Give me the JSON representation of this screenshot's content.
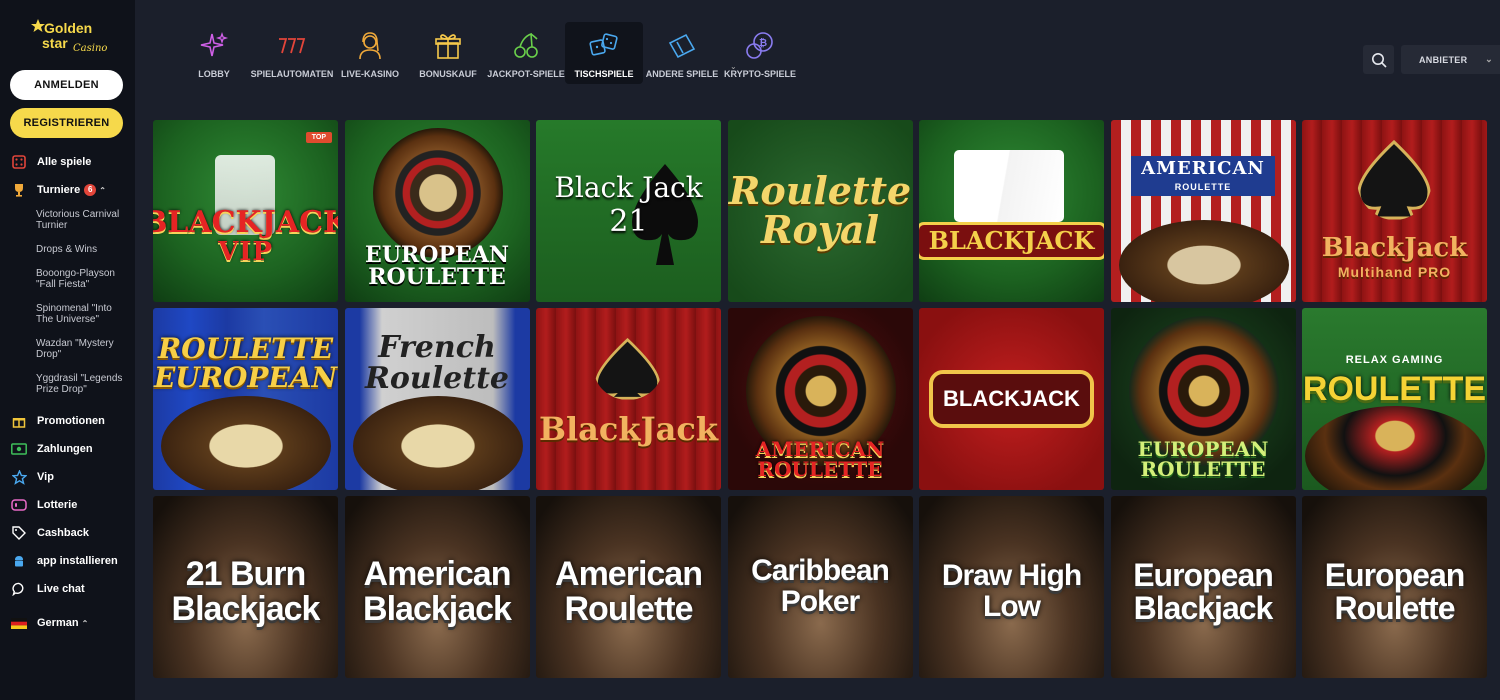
{
  "brand": {
    "line1": "Golden",
    "line2": "star",
    "line3": "Casino"
  },
  "auth": {
    "login": "ANMELDEN",
    "register": "REGISTRIEREN"
  },
  "sidebar": {
    "items": [
      {
        "label": "Alle spiele",
        "icon": "dice-icon"
      },
      {
        "label": "Turniere",
        "icon": "trophy-icon",
        "badge": "6"
      },
      {
        "label": "Promotionen",
        "icon": "gift-icon"
      },
      {
        "label": "Zahlungen",
        "icon": "cash-icon"
      },
      {
        "label": "Vip",
        "icon": "star-icon"
      },
      {
        "label": "Lotterie",
        "icon": "ticket-icon"
      },
      {
        "label": "Cashback",
        "icon": "tag-icon"
      },
      {
        "label": "app installieren",
        "icon": "android-icon"
      },
      {
        "label": "Live chat",
        "icon": "chat-icon"
      }
    ],
    "tournaments": [
      "Victorious Carnival Turnier",
      "Drops & Wins",
      "Booongo-Playson \"Fall Fiesta\"",
      "Spinomenal \"Into The Universe\"",
      "Wazdan \"Mystery Drop\"",
      "Yggdrasil \"Legends Prize Drop\""
    ],
    "language": "German"
  },
  "categories": [
    {
      "label": "LOBBY",
      "icon": "sparkle-icon"
    },
    {
      "label": "SPIELAUTOMATEN",
      "icon": "slot-777-icon"
    },
    {
      "label": "LIVE-KASINO",
      "icon": "dealer-icon"
    },
    {
      "label": "BONUSKAUF",
      "icon": "gift-box-icon"
    },
    {
      "label": "JACKPOT-SPIELE",
      "icon": "cherries-icon"
    },
    {
      "label": "TISCHSPIELE",
      "icon": "dice-pair-icon"
    },
    {
      "label": "ANDERE SPIELE",
      "icon": "ticket-card-icon"
    },
    {
      "label": "KRYPTO-SPIELE",
      "icon": "crypto-coin-icon"
    }
  ],
  "active_category": "TISCHSPIELE",
  "provider_label": "ANBIETER",
  "top_badge": "TOP",
  "games": [
    {
      "title": "BLACKJACK",
      "sub": "VIP"
    },
    {
      "title": "EUROPEAN ROULETTE",
      "sub": ""
    },
    {
      "title": "Black Jack",
      "sub": "21"
    },
    {
      "title": "Roulette Royal",
      "sub": ""
    },
    {
      "title": "BLACKJACK",
      "sub": ""
    },
    {
      "title": "AMERICAN",
      "sub": "ROULETTE"
    },
    {
      "title": "BlackJack",
      "sub": "Multihand PRO"
    },
    {
      "title": "ROULETTE EUROPEAN",
      "sub": ""
    },
    {
      "title": "French Roulette",
      "sub": ""
    },
    {
      "title": "BlackJack",
      "sub": ""
    },
    {
      "title": "AMERICAN ROULETTE",
      "sub": ""
    },
    {
      "title": "BLACKJACK",
      "sub": ""
    },
    {
      "title": "EUROPEAN ROULETTE",
      "sub": ""
    },
    {
      "title": "ROULETTE",
      "sub": "RELAX GAMING"
    },
    {
      "title": "21 Burn Blackjack",
      "sub": ""
    },
    {
      "title": "American Blackjack",
      "sub": ""
    },
    {
      "title": "American Roulette",
      "sub": ""
    },
    {
      "title": "Caribbean Poker",
      "sub": ""
    },
    {
      "title": "Draw High Low",
      "sub": ""
    },
    {
      "title": "European Blackjack",
      "sub": ""
    },
    {
      "title": "European Roulette",
      "sub": ""
    }
  ]
}
